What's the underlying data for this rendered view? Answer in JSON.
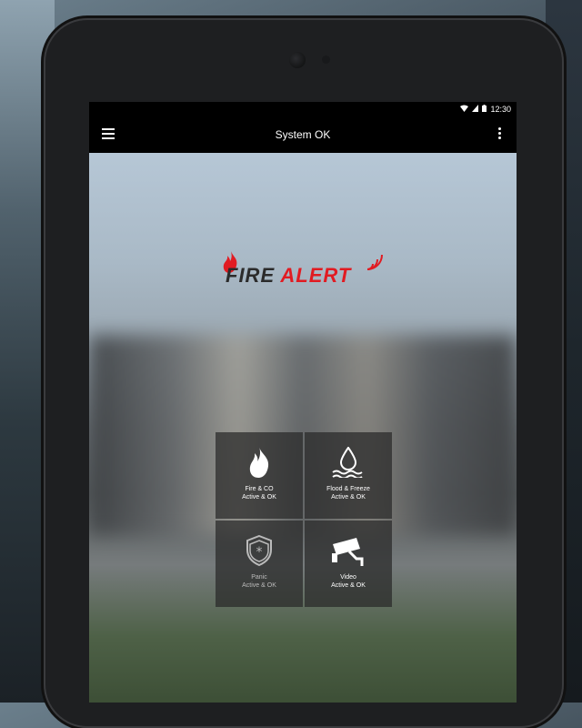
{
  "status_bar": {
    "time": "12:30"
  },
  "toolbar": {
    "title": "System OK"
  },
  "logo": {
    "word1": "FIRE",
    "word2": "ALERT"
  },
  "tiles": [
    {
      "line1": "Fire & CO",
      "line2": "Active & OK",
      "icon": "flame-icon"
    },
    {
      "line1": "Flood & Freeze",
      "line2": "Active & OK",
      "icon": "water-drop-icon"
    },
    {
      "line1": "Panic",
      "line2": "Active & OK",
      "icon": "shield-icon"
    },
    {
      "line1": "Video",
      "line2": "Active & OK",
      "icon": "security-camera-icon"
    }
  ],
  "colors": {
    "brand_red": "#e11b22",
    "toolbar": "#000000"
  }
}
